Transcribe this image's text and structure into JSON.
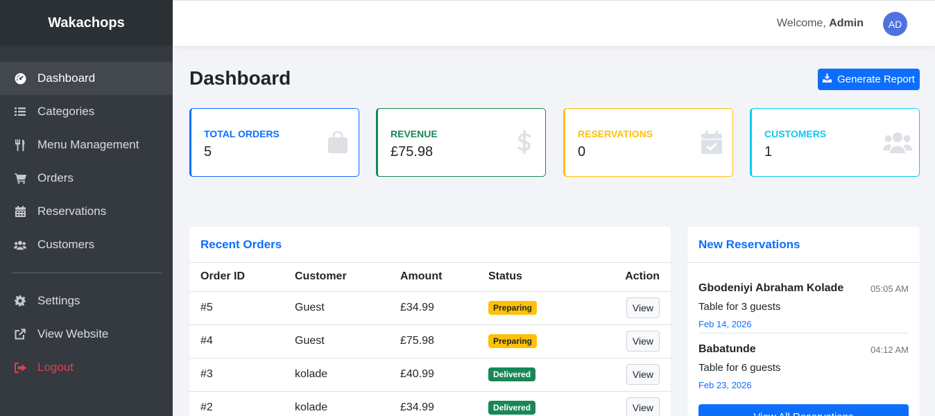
{
  "brand": "Wakachops",
  "sidebar": {
    "items": [
      {
        "label": "Dashboard",
        "icon": "tachometer-icon"
      },
      {
        "label": "Categories",
        "icon": "list-icon"
      },
      {
        "label": "Menu Management",
        "icon": "utensils-icon"
      },
      {
        "label": "Orders",
        "icon": "cart-icon"
      },
      {
        "label": "Reservations",
        "icon": "calendar-icon"
      },
      {
        "label": "Customers",
        "icon": "users-icon"
      }
    ],
    "bottom": [
      {
        "label": "Settings",
        "icon": "gear-icon"
      },
      {
        "label": "View Website",
        "icon": "external-link-icon"
      },
      {
        "label": "Logout",
        "icon": "sign-out-icon"
      }
    ]
  },
  "topbar": {
    "welcome": "Welcome,",
    "user": "Admin",
    "avatar": "AD"
  },
  "page": {
    "title": "Dashboard",
    "report_button": "Generate Report"
  },
  "cards": [
    {
      "label": "TOTAL ORDERS",
      "value": "5",
      "color": "#0d6efd",
      "icon": "shopping-bag-icon"
    },
    {
      "label": "REVENUE",
      "value": "£75.98",
      "color": "#198754",
      "icon": "dollar-icon"
    },
    {
      "label": "RESERVATIONS",
      "value": "0",
      "color": "#ffc107",
      "icon": "calendar-check-icon"
    },
    {
      "label": "CUSTOMERS",
      "value": "1",
      "color": "#0dcaf0",
      "icon": "users-icon"
    }
  ],
  "orders": {
    "title": "Recent Orders",
    "headers": [
      "Order ID",
      "Customer",
      "Amount",
      "Status",
      "Action"
    ],
    "rows": [
      {
        "id": "#5",
        "customer": "Guest",
        "amount": "£34.99",
        "status": "Preparing",
        "action": "View"
      },
      {
        "id": "#4",
        "customer": "Guest",
        "amount": "£75.98",
        "status": "Preparing",
        "action": "View"
      },
      {
        "id": "#3",
        "customer": "kolade",
        "amount": "£40.99",
        "status": "Delivered",
        "action": "View"
      },
      {
        "id": "#2",
        "customer": "kolade",
        "amount": "£34.99",
        "status": "Delivered",
        "action": "View"
      }
    ]
  },
  "reservations": {
    "title": "New Reservations",
    "items": [
      {
        "name": "Gbodeniyi Abraham Kolade",
        "time": "05:05 AM",
        "desc": "Table for 3 guests",
        "date": "Feb 14, 2026"
      },
      {
        "name": "Babatunde",
        "time": "04:12 AM",
        "desc": "Table for 6 guests",
        "date": "Feb 23, 2026"
      }
    ],
    "button": "View All Reservations"
  }
}
